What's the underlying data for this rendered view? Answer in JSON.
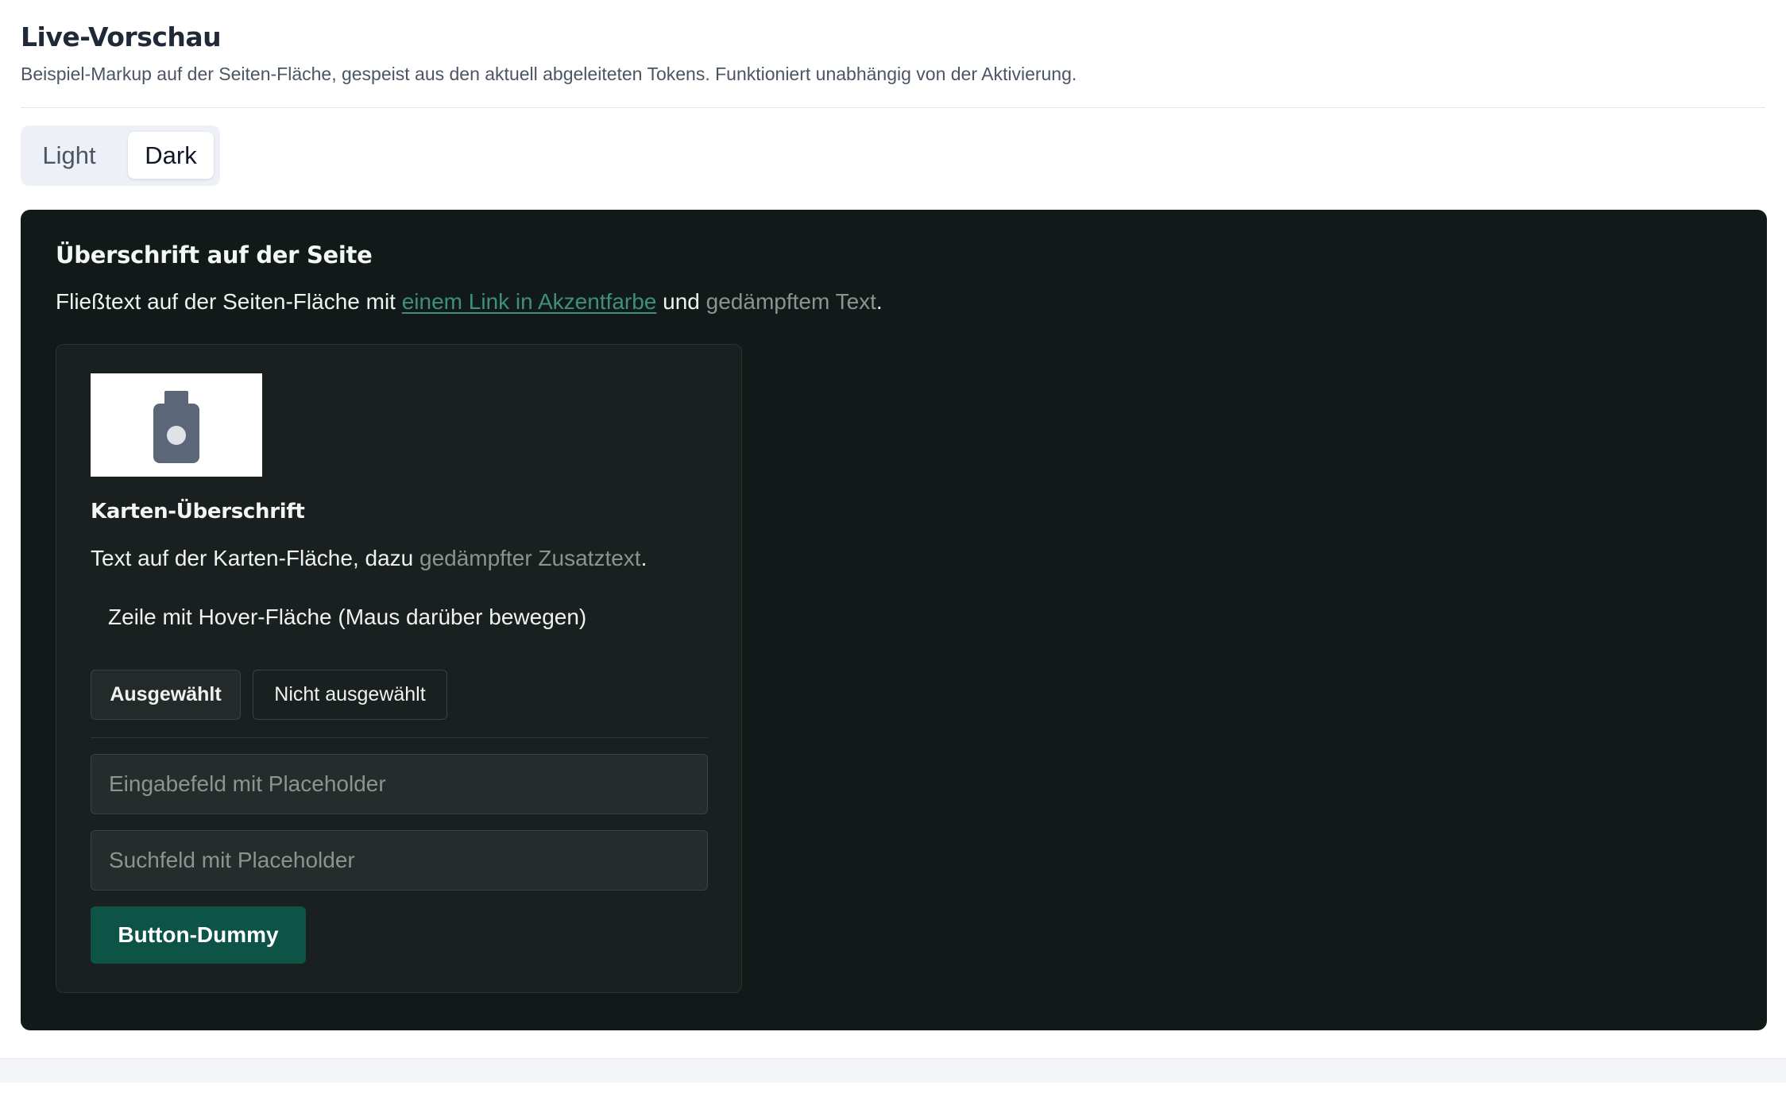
{
  "header": {
    "title": "Live-Vorschau",
    "description": "Beispiel-Markup auf der Seiten-Fläche, gespeist aus den aktuell abgeleiteten Tokens. Funktioniert unabhängig von der Aktivierung."
  },
  "mode_toggle": {
    "options": [
      "Light",
      "Dark"
    ],
    "selected": "Dark"
  },
  "preview": {
    "heading": "Überschrift auf der Seite",
    "body_prefix": "Fließtext auf der Seiten-Fläche mit ",
    "link_text": "einem Link in Akzentfarbe",
    "body_middle": " und ",
    "muted_text": "gedämpftem Text",
    "body_suffix": ".",
    "card": {
      "image_icon": "bottle-icon",
      "title": "Karten-Überschrift",
      "text_prefix": "Text auf der Karten-Fläche, dazu ",
      "text_muted": "gedämpfter Zusatztext",
      "text_suffix": ".",
      "hover_row": "Zeile mit Hover-Fläche (Maus darüber bewegen)",
      "chip_selected": "Ausgewählt",
      "chip_unselected": "Nicht ausgewählt",
      "input_placeholder": "Eingabefeld mit Placeholder",
      "search_placeholder": "Suchfeld mit Placeholder",
      "button_label": "Button-Dummy"
    }
  },
  "colors": {
    "preview_surface": "#111a19",
    "card_surface": "#19201f",
    "accent_link": "#3f8f7e",
    "muted_text": "#8a9491",
    "primary_button": "#0d5447"
  }
}
